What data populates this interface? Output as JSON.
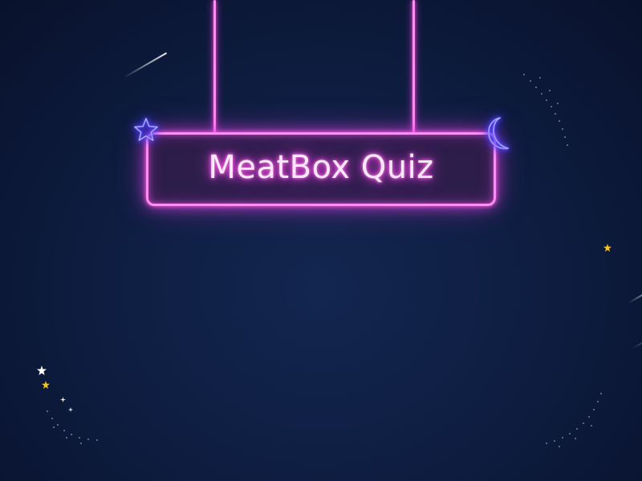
{
  "sign": {
    "title": "MeatBox Quiz"
  },
  "icons": {
    "star": "star-outline-icon",
    "moon": "crescent-moon-icon",
    "small_star": "small-star-icon",
    "sparkle": "sparkle-icon"
  },
  "colors": {
    "background": "#0f1f44",
    "neon_pink": "#ff8df2",
    "neon_glow": "#d13bd7",
    "neon_blue": "#3a2fff",
    "title_text": "#ffe9ff",
    "gold_star": "#f5c518"
  }
}
